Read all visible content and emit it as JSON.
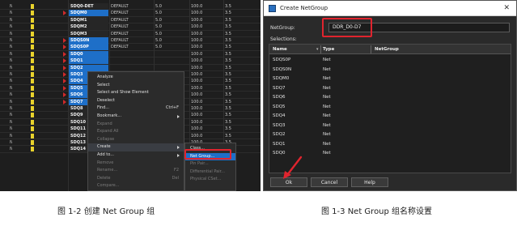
{
  "left": {
    "rows": [
      {
        "name": "SDQ0-DET",
        "grp": "DEFAULT",
        "a": "5.0",
        "b": "100.0",
        "c": "3.5",
        "sel": false
      },
      {
        "name": "SDQM0",
        "grp": "DEFAULT",
        "a": "5.0",
        "b": "100.0",
        "c": "3.5",
        "sel": true
      },
      {
        "name": "SDQM1",
        "grp": "DEFAULT",
        "a": "5.0",
        "b": "100.0",
        "c": "3.5",
        "sel": false
      },
      {
        "name": "SDQM2",
        "grp": "DEFAULT",
        "a": "5.0",
        "b": "100.0",
        "c": "3.5",
        "sel": false
      },
      {
        "name": "SDQM3",
        "grp": "DEFAULT",
        "a": "5.0",
        "b": "100.0",
        "c": "3.5",
        "sel": false
      },
      {
        "name": "SDQS0N",
        "grp": "DEFAULT",
        "a": "5.0",
        "b": "100.0",
        "c": "3.5",
        "sel": true
      },
      {
        "name": "SDQS0P",
        "grp": "DEFAULT",
        "a": "5.0",
        "b": "100.0",
        "c": "3.5",
        "sel": true
      },
      {
        "name": "SDQ0",
        "grp": "",
        "a": "",
        "b": "100.0",
        "c": "3.5",
        "sel": true
      },
      {
        "name": "SDQ1",
        "grp": "",
        "a": "",
        "b": "100.0",
        "c": "3.5",
        "sel": true
      },
      {
        "name": "SDQ2",
        "grp": "",
        "a": "",
        "b": "100.0",
        "c": "3.5",
        "sel": true
      },
      {
        "name": "SDQ3",
        "grp": "",
        "a": "",
        "b": "100.0",
        "c": "3.5",
        "sel": true
      },
      {
        "name": "SDQ4",
        "grp": "",
        "a": "",
        "b": "100.0",
        "c": "3.5",
        "sel": true
      },
      {
        "name": "SDQ5",
        "grp": "",
        "a": "",
        "b": "100.0",
        "c": "3.5",
        "sel": true
      },
      {
        "name": "SDQ6",
        "grp": "",
        "a": "",
        "b": "100.0",
        "c": "3.5",
        "sel": true
      },
      {
        "name": "SDQ7",
        "grp": "",
        "a": "",
        "b": "100.0",
        "c": "3.5",
        "sel": true
      },
      {
        "name": "SDQ8",
        "grp": "",
        "a": "",
        "b": "100.0",
        "c": "3.5",
        "sel": false
      },
      {
        "name": "SDQ9",
        "grp": "",
        "a": "",
        "b": "100.0",
        "c": "3.5",
        "sel": false
      },
      {
        "name": "SDQ10",
        "grp": "",
        "a": "",
        "b": "100.0",
        "c": "3.5",
        "sel": false
      },
      {
        "name": "SDQ11",
        "grp": "",
        "a": "",
        "b": "100.0",
        "c": "3.5",
        "sel": false
      },
      {
        "name": "SDQ12",
        "grp": "",
        "a": "",
        "b": "100.0",
        "c": "3.5",
        "sel": false
      },
      {
        "name": "SDQ13",
        "grp": "",
        "a": "",
        "b": "100.0",
        "c": "3.5",
        "sel": false
      },
      {
        "name": "SDQ14",
        "grp": "",
        "a": "",
        "b": "100.0",
        "c": "3.5",
        "sel": false
      }
    ],
    "menu": [
      {
        "label": "Analyze",
        "shortcut": "",
        "disabled": false,
        "sub": false
      },
      {
        "label": "Select",
        "shortcut": "",
        "disabled": false,
        "sub": false
      },
      {
        "label": "Select and Show Element",
        "shortcut": "",
        "disabled": false,
        "sub": false
      },
      {
        "label": "Deselect",
        "shortcut": "",
        "disabled": false,
        "sub": false
      },
      {
        "label": "Find...",
        "shortcut": "Ctrl+F",
        "disabled": false,
        "sub": false
      },
      {
        "label": "Bookmark...",
        "shortcut": "",
        "disabled": false,
        "sub": true
      },
      {
        "label": "Expand",
        "shortcut": "",
        "disabled": true,
        "sub": false
      },
      {
        "label": "Expand All",
        "shortcut": "",
        "disabled": true,
        "sub": false
      },
      {
        "label": "Collapse",
        "shortcut": "",
        "disabled": true,
        "sub": false
      },
      {
        "label": "Create",
        "shortcut": "",
        "disabled": false,
        "sub": true
      },
      {
        "label": "Add to...",
        "shortcut": "",
        "disabled": false,
        "sub": true
      },
      {
        "label": "Remove",
        "shortcut": "",
        "disabled": true,
        "sub": false
      },
      {
        "label": "Rename...",
        "shortcut": "F2",
        "disabled": true,
        "sub": false
      },
      {
        "label": "Delete",
        "shortcut": "Del",
        "disabled": true,
        "sub": false
      },
      {
        "label": "Compare...",
        "shortcut": "",
        "disabled": true,
        "sub": false
      }
    ],
    "submenu": [
      {
        "label": "Class...",
        "disabled": false
      },
      {
        "label": "Net Group...",
        "disabled": false
      },
      {
        "label": "Pin Pair...",
        "disabled": true
      },
      {
        "label": "Differential Pair...",
        "disabled": true
      },
      {
        "label": "Physical CSet...",
        "disabled": true
      }
    ]
  },
  "dialog": {
    "title": "Create NetGroup",
    "close": "✕",
    "netgroup_label": "NetGroup:",
    "netgroup_value": "DDR_D0-D7",
    "selections_label": "Selections:",
    "col_name": "Name",
    "col_type": "Type",
    "col_netgroup": "NetGroup",
    "rows": [
      {
        "name": "SDQS0P",
        "type": "Net"
      },
      {
        "name": "SDQS0N",
        "type": "Net"
      },
      {
        "name": "SDQM0",
        "type": "Net"
      },
      {
        "name": "SDQ7",
        "type": "Net"
      },
      {
        "name": "SDQ6",
        "type": "Net"
      },
      {
        "name": "SDQ5",
        "type": "Net"
      },
      {
        "name": "SDQ4",
        "type": "Net"
      },
      {
        "name": "SDQ3",
        "type": "Net"
      },
      {
        "name": "SDQ2",
        "type": "Net"
      },
      {
        "name": "SDQ1",
        "type": "Net"
      },
      {
        "name": "SDQ0",
        "type": "Net"
      }
    ],
    "ok": "Ok",
    "cancel": "Cancel",
    "help": "Help"
  },
  "captions": {
    "left": "图 1-2 创建 Net Group 组",
    "right": "图 1-3 Net Group 组名称设置"
  },
  "colors": {
    "highlight": "#e0242e",
    "selection": "#1e6fc8"
  }
}
